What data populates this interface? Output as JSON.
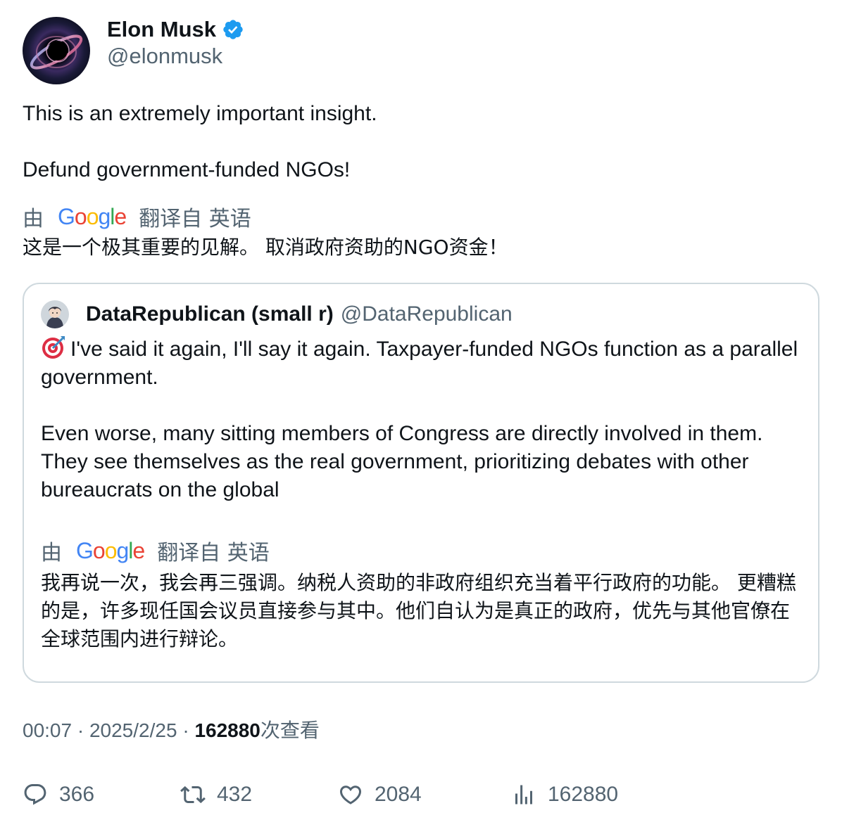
{
  "tweet": {
    "author": {
      "display_name": "Elon Musk",
      "handle": "@elonmusk",
      "verified": true
    },
    "text": "This is an extremely important insight.\n\nDefund government-funded NGOs!",
    "translation": {
      "prefix": "由",
      "provider": "Google",
      "suffix": "翻译自 英语",
      "text": "这是一个极其重要的见解。 取消政府资助的NGO资金！"
    },
    "quote": {
      "author": {
        "display_name": "DataRepublican (small r)",
        "handle": "@DataRepublican"
      },
      "emoji": "direct-hit-icon",
      "text": "I've said it again, I'll say it again. Taxpayer-funded NGOs function as a parallel government.\n\nEven worse, many sitting members of Congress are directly involved in them. They see themselves as the real government, prioritizing debates with other bureaucrats on the global",
      "translation": {
        "prefix": "由",
        "provider": "Google",
        "suffix": "翻译自 英语",
        "text": "我再说一次，我会再三强调。纳税人资助的非政府组织充当着平行政府的功能。 更糟糕的是，许多现任国会议员直接参与其中。他们自认为是真正的政府，优先与其他官僚在全球范围内进行辩论。"
      }
    },
    "meta": {
      "time": "00:07",
      "date": "2025/2/25",
      "separator": "·",
      "views": "162880",
      "views_label": "次查看"
    },
    "actions": {
      "replies": "366",
      "retweets": "432",
      "likes": "2084",
      "views": "162880"
    }
  },
  "colors": {
    "text": "#0f1419",
    "secondary": "#536471",
    "border": "#cfd9de",
    "verified": "#1d9bf0"
  }
}
